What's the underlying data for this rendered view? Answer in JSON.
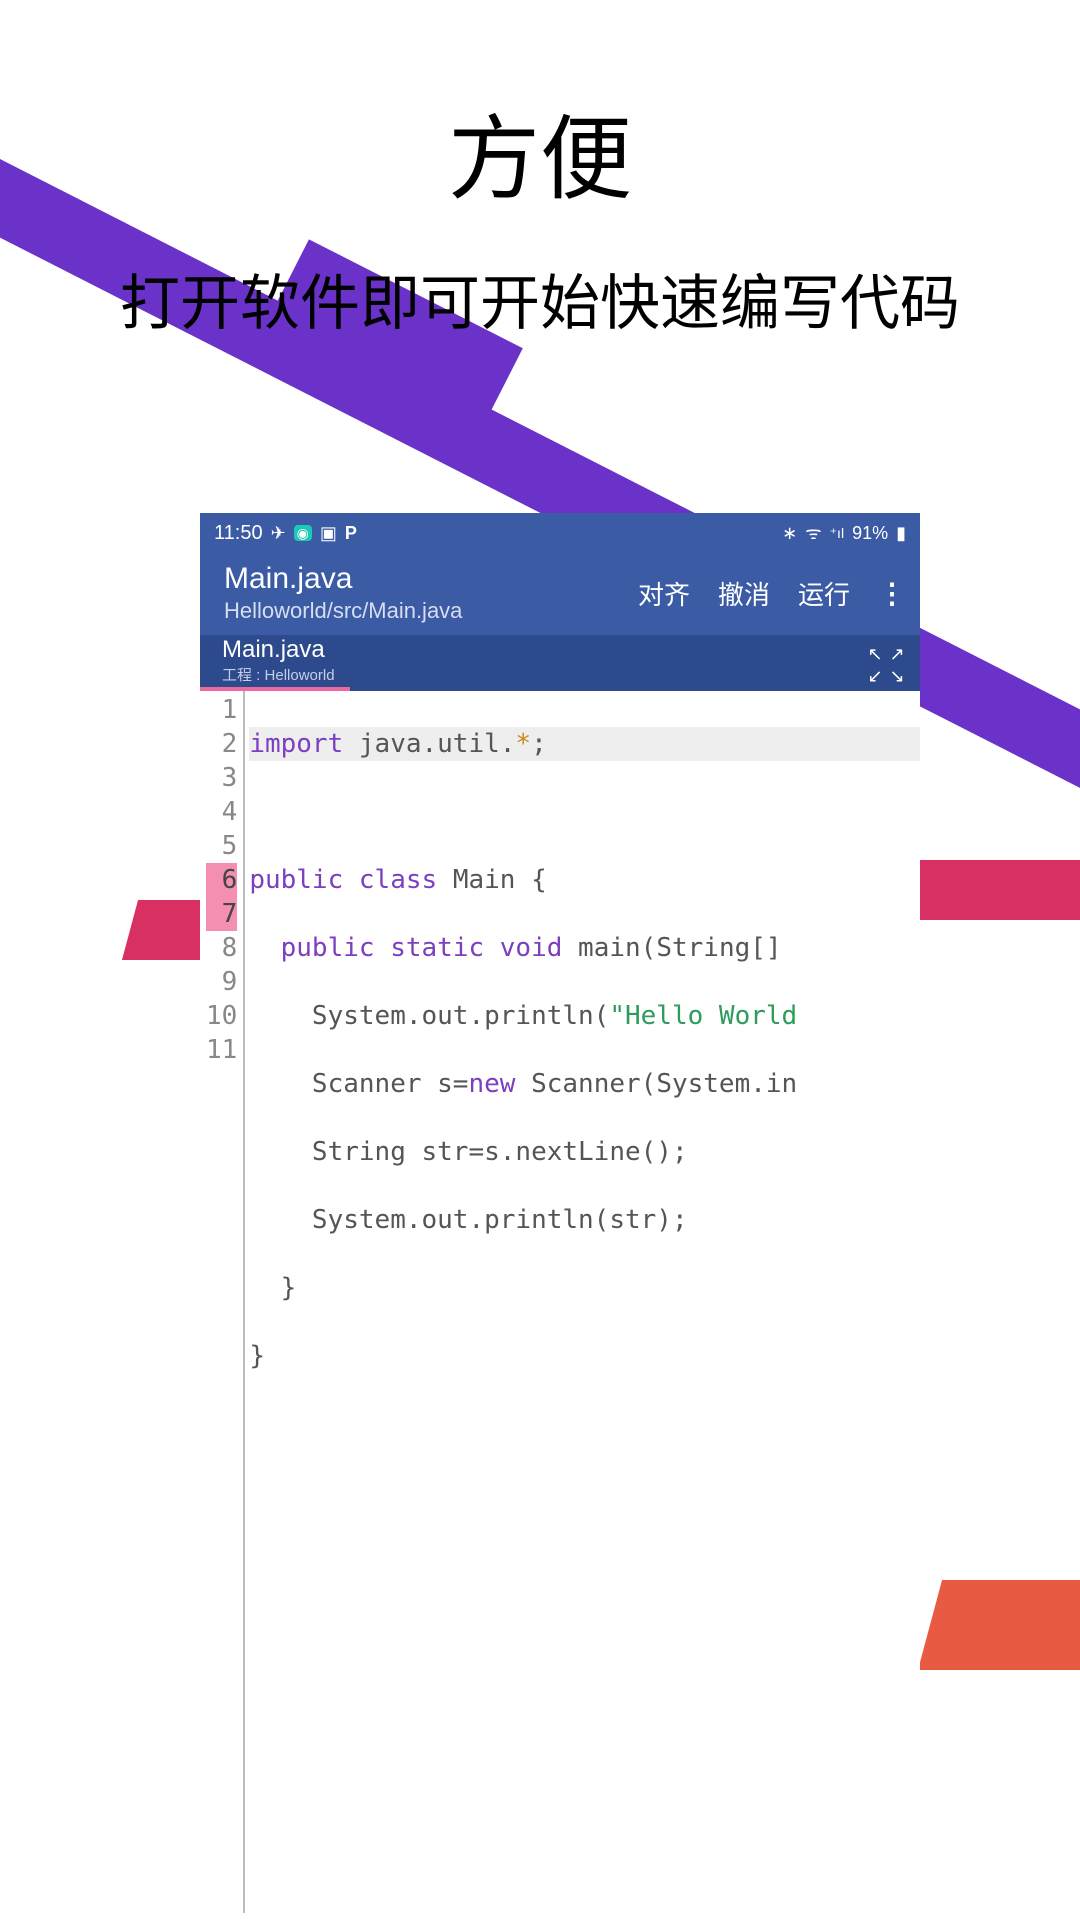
{
  "promo": {
    "title": "方便",
    "subtitle": "打开软件即可开始快速编写代码"
  },
  "statusbar": {
    "time": "11:50",
    "icons_left": [
      "send-icon",
      "camera-icon",
      "stop-icon",
      "p-icon"
    ],
    "icons_right_text": "✱  ᯤ ₓ⎸91% ▮",
    "battery_pct": "91%"
  },
  "appbar": {
    "title": "Main.java",
    "path": "Helloworld/src/Main.java",
    "actions": {
      "align": "对齐",
      "undo": "撤消",
      "run": "运行"
    }
  },
  "tab": {
    "file": "Main.java",
    "project_prefix": "工程 : ",
    "project_name": "Helloworld"
  },
  "editor": {
    "line_count": 11,
    "highlight_lines": [
      6,
      7
    ],
    "current_line": 1,
    "tokens": {
      "l1_kw": "import",
      "l1_rest": " java.util.",
      "l1_star": "*",
      "l1_semi": ";",
      "l3_kw1": "public",
      "l3_kw2": "class",
      "l3_rest": " Main {",
      "l4_kw1": "public",
      "l4_kw2": "static",
      "l4_kw3": "void",
      "l4_rest": " main(String[]",
      "l5_a": "    System.out.println(",
      "l5_str": "\"Hello World",
      "l6_a": "    Scanner s=",
      "l6_kw": "new",
      "l6_b": " Scanner(System.in",
      "l7": "    String str=s.nextLine();",
      "l8": "    System.out.println(str);",
      "l9": "  }",
      "l10": "}"
    }
  }
}
